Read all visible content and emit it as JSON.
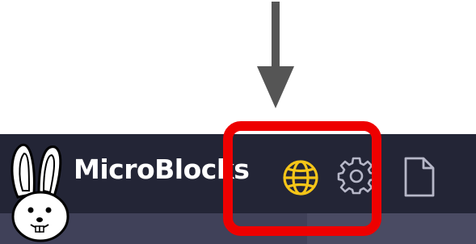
{
  "app": {
    "title": "MicroBlocks"
  },
  "toolbar": {
    "buttons": [
      {
        "icon": "globe-icon",
        "purpose": "language"
      },
      {
        "icon": "gear-icon",
        "purpose": "settings"
      },
      {
        "icon": "file-icon",
        "purpose": "file"
      }
    ]
  },
  "colors": {
    "titlebar": "#232536",
    "accent_globe": "#f5c518",
    "icon_gray": "#b6b7c8",
    "highlight": "#ee0000",
    "arrow": "#555555"
  }
}
